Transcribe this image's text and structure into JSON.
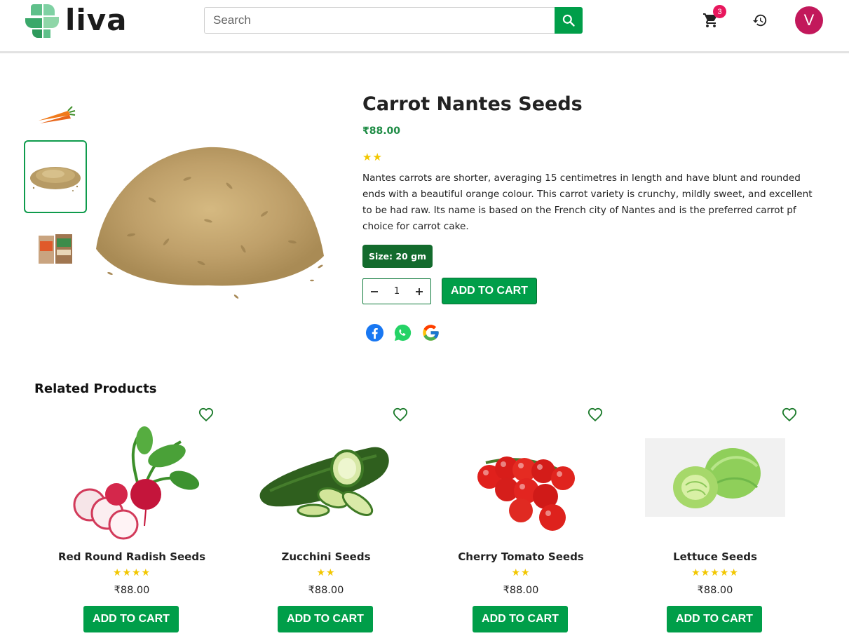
{
  "header": {
    "logo_text": "liva",
    "search_placeholder": "Search",
    "cart_count": "3",
    "avatar_initial": "V"
  },
  "icons": {
    "search": "search-icon",
    "cart": "cart-icon",
    "history": "history-icon",
    "heart": "heart-outline-icon",
    "facebook": "facebook-icon",
    "whatsapp": "whatsapp-icon",
    "google": "google-icon"
  },
  "colors": {
    "brand_green": "#009e49",
    "size_badge": "#136b2d",
    "price_green": "#1e8c45",
    "star": "#f2c700",
    "badge_pink": "#e8175d",
    "avatar": "#c2185b"
  },
  "product": {
    "title": "Carrot Nantes Seeds",
    "price": "₹88.00",
    "stars": "★★",
    "rating": 2,
    "description": "Nantes carrots are shorter, averaging 15 centimetres in length and have blunt and rounded ends with a beautiful orange colour. This carrot variety is crunchy, mildly sweet, and excellent to be had raw. Its name is based on the French city of Nantes and is the preferred carrot pf choice for carrot cake.",
    "size_label": "Size: 20 gm",
    "quantity": "1",
    "add_to_cart_label": "ADD TO CART"
  },
  "related": {
    "title": "Related Products",
    "items": [
      {
        "name": "Red Round Radish Seeds",
        "stars": "★★★★",
        "rating": 4,
        "price": "₹88.00",
        "button": "ADD TO CART"
      },
      {
        "name": "Zucchini Seeds",
        "stars": "★★",
        "rating": 2,
        "price": "₹88.00",
        "button": "ADD TO CART"
      },
      {
        "name": "Cherry Tomato Seeds",
        "stars": "★★",
        "rating": 2,
        "price": "₹88.00",
        "button": "ADD TO CART"
      },
      {
        "name": "Lettuce Seeds",
        "stars": "★★★★★",
        "rating": 5,
        "price": "₹88.00",
        "button": "ADD TO CART"
      }
    ]
  }
}
